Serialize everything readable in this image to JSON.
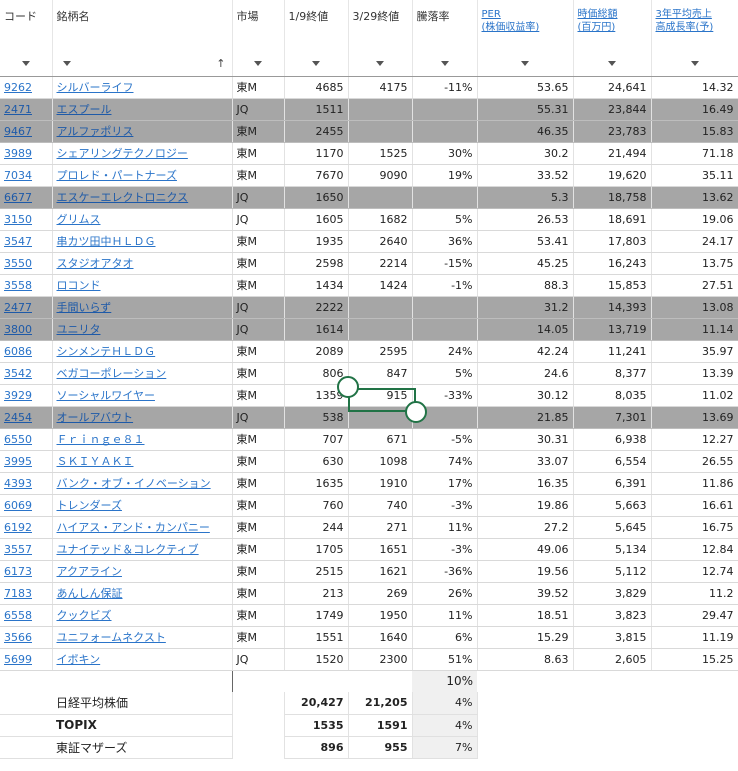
{
  "headers": {
    "code": "コード",
    "name": "銘柄名",
    "market": "市場",
    "close_jan": "1/9終値",
    "close_mar": "3/29終値",
    "change": "騰落率",
    "per_line1": "PER",
    "per_line2": "(株価収益率)",
    "cap_line1": "時価総額",
    "cap_line2": "(百万円)",
    "growth_line1": "3年平均売上",
    "growth_line2": "高成長率(予)"
  },
  "sort_arrow": "↑",
  "rows": [
    {
      "code": "9262",
      "name": "シルバーライフ",
      "market": "東M",
      "jan": "4685",
      "mar": "4175",
      "chg": "-11%",
      "per": "53.65",
      "cap": "24,641",
      "growth": "14.32",
      "grey": false
    },
    {
      "code": "2471",
      "name": "エスプール",
      "market": "JQ",
      "jan": "1511",
      "mar": "",
      "chg": "",
      "per": "55.31",
      "cap": "23,844",
      "growth": "16.49",
      "grey": true
    },
    {
      "code": "9467",
      "name": "アルファポリス",
      "market": "東M",
      "jan": "2455",
      "mar": "",
      "chg": "",
      "per": "46.35",
      "cap": "23,783",
      "growth": "15.83",
      "grey": true
    },
    {
      "code": "3989",
      "name": "シェアリングテクノロジー",
      "market": "東M",
      "jan": "1170",
      "mar": "1525",
      "chg": "30%",
      "per": "30.2",
      "cap": "21,494",
      "growth": "71.18",
      "grey": false
    },
    {
      "code": "7034",
      "name": "プロレド・パートナーズ",
      "market": "東M",
      "jan": "7670",
      "mar": "9090",
      "chg": "19%",
      "per": "33.52",
      "cap": "19,620",
      "growth": "35.11",
      "grey": false
    },
    {
      "code": "6677",
      "name": "エスケーエレクトロニクス",
      "market": "JQ",
      "jan": "1650",
      "mar": "",
      "chg": "",
      "per": "5.3",
      "cap": "18,758",
      "growth": "13.62",
      "grey": true
    },
    {
      "code": "3150",
      "name": "グリムス",
      "market": "JQ",
      "jan": "1605",
      "mar": "1682",
      "chg": "5%",
      "per": "26.53",
      "cap": "18,691",
      "growth": "19.06",
      "grey": false
    },
    {
      "code": "3547",
      "name": "串カツ田中ＨＬＤＧ",
      "market": "東M",
      "jan": "1935",
      "mar": "2640",
      "chg": "36%",
      "per": "53.41",
      "cap": "17,803",
      "growth": "24.17",
      "grey": false
    },
    {
      "code": "3550",
      "name": "スタジオアタオ",
      "market": "東M",
      "jan": "2598",
      "mar": "2214",
      "chg": "-15%",
      "per": "45.25",
      "cap": "16,243",
      "growth": "13.75",
      "grey": false
    },
    {
      "code": "3558",
      "name": "ロコンド",
      "market": "東M",
      "jan": "1434",
      "mar": "1424",
      "chg": "-1%",
      "per": "88.3",
      "cap": "15,853",
      "growth": "27.51",
      "grey": false
    },
    {
      "code": "2477",
      "name": "手間いらず",
      "market": "JQ",
      "jan": "2222",
      "mar": "",
      "chg": "",
      "per": "31.2",
      "cap": "14,393",
      "growth": "13.08",
      "grey": true
    },
    {
      "code": "3800",
      "name": "ユニリタ",
      "market": "JQ",
      "jan": "1614",
      "mar": "",
      "chg": "",
      "per": "14.05",
      "cap": "13,719",
      "growth": "11.14",
      "grey": true
    },
    {
      "code": "6086",
      "name": "シンメンテＨＬＤＧ",
      "market": "東M",
      "jan": "2089",
      "mar": "2595",
      "chg": "24%",
      "per": "42.24",
      "cap": "11,241",
      "growth": "35.97",
      "grey": false
    },
    {
      "code": "3542",
      "name": "ベガコーポレーション",
      "market": "東M",
      "jan": "806",
      "mar": "847",
      "chg": "5%",
      "per": "24.6",
      "cap": "8,377",
      "growth": "13.39",
      "grey": false
    },
    {
      "code": "3929",
      "name": "ソーシャルワイヤー",
      "market": "東M",
      "jan": "1359",
      "mar": "915",
      "chg": "-33%",
      "per": "30.12",
      "cap": "8,035",
      "growth": "11.02",
      "grey": false
    },
    {
      "code": "2454",
      "name": "オールアバウト",
      "market": "JQ",
      "jan": "538",
      "mar": "",
      "chg": "",
      "per": "21.85",
      "cap": "7,301",
      "growth": "13.69",
      "grey": true
    },
    {
      "code": "6550",
      "name": "Ｆｒｉｎｇｅ８１",
      "market": "東M",
      "jan": "707",
      "mar": "671",
      "chg": "-5%",
      "per": "30.31",
      "cap": "6,938",
      "growth": "12.27",
      "grey": false
    },
    {
      "code": "3995",
      "name": "ＳＫＩＹＡＫＩ",
      "market": "東M",
      "jan": "630",
      "mar": "1098",
      "chg": "74%",
      "per": "33.07",
      "cap": "6,554",
      "growth": "26.55",
      "grey": false
    },
    {
      "code": "4393",
      "name": "バンク・オブ・イノベーション",
      "market": "東M",
      "jan": "1635",
      "mar": "1910",
      "chg": "17%",
      "per": "16.35",
      "cap": "6,391",
      "growth": "11.86",
      "grey": false
    },
    {
      "code": "6069",
      "name": "トレンダーズ",
      "market": "東M",
      "jan": "760",
      "mar": "740",
      "chg": "-3%",
      "per": "19.86",
      "cap": "5,663",
      "growth": "16.61",
      "grey": false
    },
    {
      "code": "6192",
      "name": "ハイアス・アンド・カンパニー",
      "market": "東M",
      "jan": "244",
      "mar": "271",
      "chg": "11%",
      "per": "27.2",
      "cap": "5,645",
      "growth": "16.75",
      "grey": false
    },
    {
      "code": "3557",
      "name": "ユナイテッド＆コレクティブ",
      "market": "東M",
      "jan": "1705",
      "mar": "1651",
      "chg": "-3%",
      "per": "49.06",
      "cap": "5,134",
      "growth": "12.84",
      "grey": false
    },
    {
      "code": "6173",
      "name": "アクアライン",
      "market": "東M",
      "jan": "2515",
      "mar": "1621",
      "chg": "-36%",
      "per": "19.56",
      "cap": "5,112",
      "growth": "12.74",
      "grey": false
    },
    {
      "code": "7183",
      "name": "あんしん保証",
      "market": "東M",
      "jan": "213",
      "mar": "269",
      "chg": "26%",
      "per": "39.52",
      "cap": "3,829",
      "growth": "11.2",
      "grey": false
    },
    {
      "code": "6558",
      "name": "クックビズ",
      "market": "東M",
      "jan": "1749",
      "mar": "1950",
      "chg": "11%",
      "per": "18.51",
      "cap": "3,823",
      "growth": "29.47",
      "grey": false
    },
    {
      "code": "3566",
      "name": "ユニフォームネクスト",
      "market": "東M",
      "jan": "1551",
      "mar": "1640",
      "chg": "6%",
      "per": "15.29",
      "cap": "3,815",
      "growth": "11.19",
      "grey": false
    },
    {
      "code": "5699",
      "name": "イボキン",
      "market": "JQ",
      "jan": "1520",
      "mar": "2300",
      "chg": "51%",
      "per": "8.63",
      "cap": "2,605",
      "growth": "15.25",
      "grey": false
    }
  ],
  "average_change": "10%",
  "summary": [
    {
      "label": "日経平均株価",
      "jan": "20,427",
      "mar": "21,205",
      "chg": "4%",
      "bold": false
    },
    {
      "label": "TOPIX",
      "jan": "1535",
      "mar": "1591",
      "chg": "4%",
      "bold": true
    },
    {
      "label": "東証マザーズ",
      "jan": "896",
      "mar": "955",
      "chg": "7%",
      "bold": false
    }
  ],
  "colors": {
    "grey_row": "#a6a6a6",
    "link": "#2a74c9",
    "selection": "#217346"
  }
}
